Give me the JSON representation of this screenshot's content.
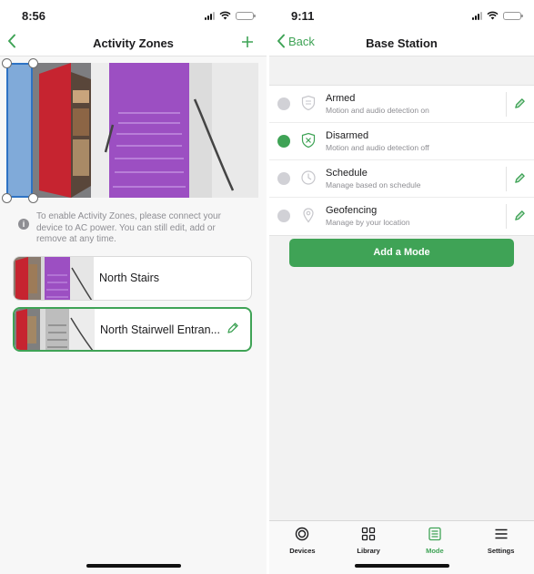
{
  "left_screen": {
    "status_bar": {
      "time": "8:56"
    },
    "nav": {
      "title": "Activity Zones"
    },
    "notice": "To enable Activity Zones, please connect your device to AC power. You can still edit, add or remove at any time.",
    "zones": [
      {
        "name": "North Stairs",
        "selected": false
      },
      {
        "name": "North Stairwell Entran...",
        "selected": true
      }
    ]
  },
  "right_screen": {
    "status_bar": {
      "time": "9:11"
    },
    "nav": {
      "back_label": "Back",
      "title": "Base Station"
    },
    "modes": [
      {
        "label": "Armed",
        "description": "Motion and audio detection on",
        "active": false,
        "icon": "shield-icon",
        "editable": true
      },
      {
        "label": "Disarmed",
        "description": "Motion and audio detection off",
        "active": true,
        "icon": "shield-x-icon",
        "editable": false
      },
      {
        "label": "Schedule",
        "description": "Manage based on schedule",
        "active": false,
        "icon": "clock-icon",
        "editable": true
      },
      {
        "label": "Geofencing",
        "description": "Manage by your location",
        "active": false,
        "icon": "location-pin-icon",
        "editable": true
      }
    ],
    "add_mode_label": "Add a Mode",
    "tabs": [
      {
        "label": "Devices",
        "icon": "devices-icon",
        "active": false
      },
      {
        "label": "Library",
        "icon": "library-grid-icon",
        "active": false
      },
      {
        "label": "Mode",
        "icon": "mode-icon",
        "active": true
      },
      {
        "label": "Settings",
        "icon": "menu-icon",
        "active": false
      }
    ]
  },
  "colors": {
    "accent": "#3fa356",
    "zone_overlay": "#408ce1",
    "zone_purple": "#9c4fc2"
  }
}
